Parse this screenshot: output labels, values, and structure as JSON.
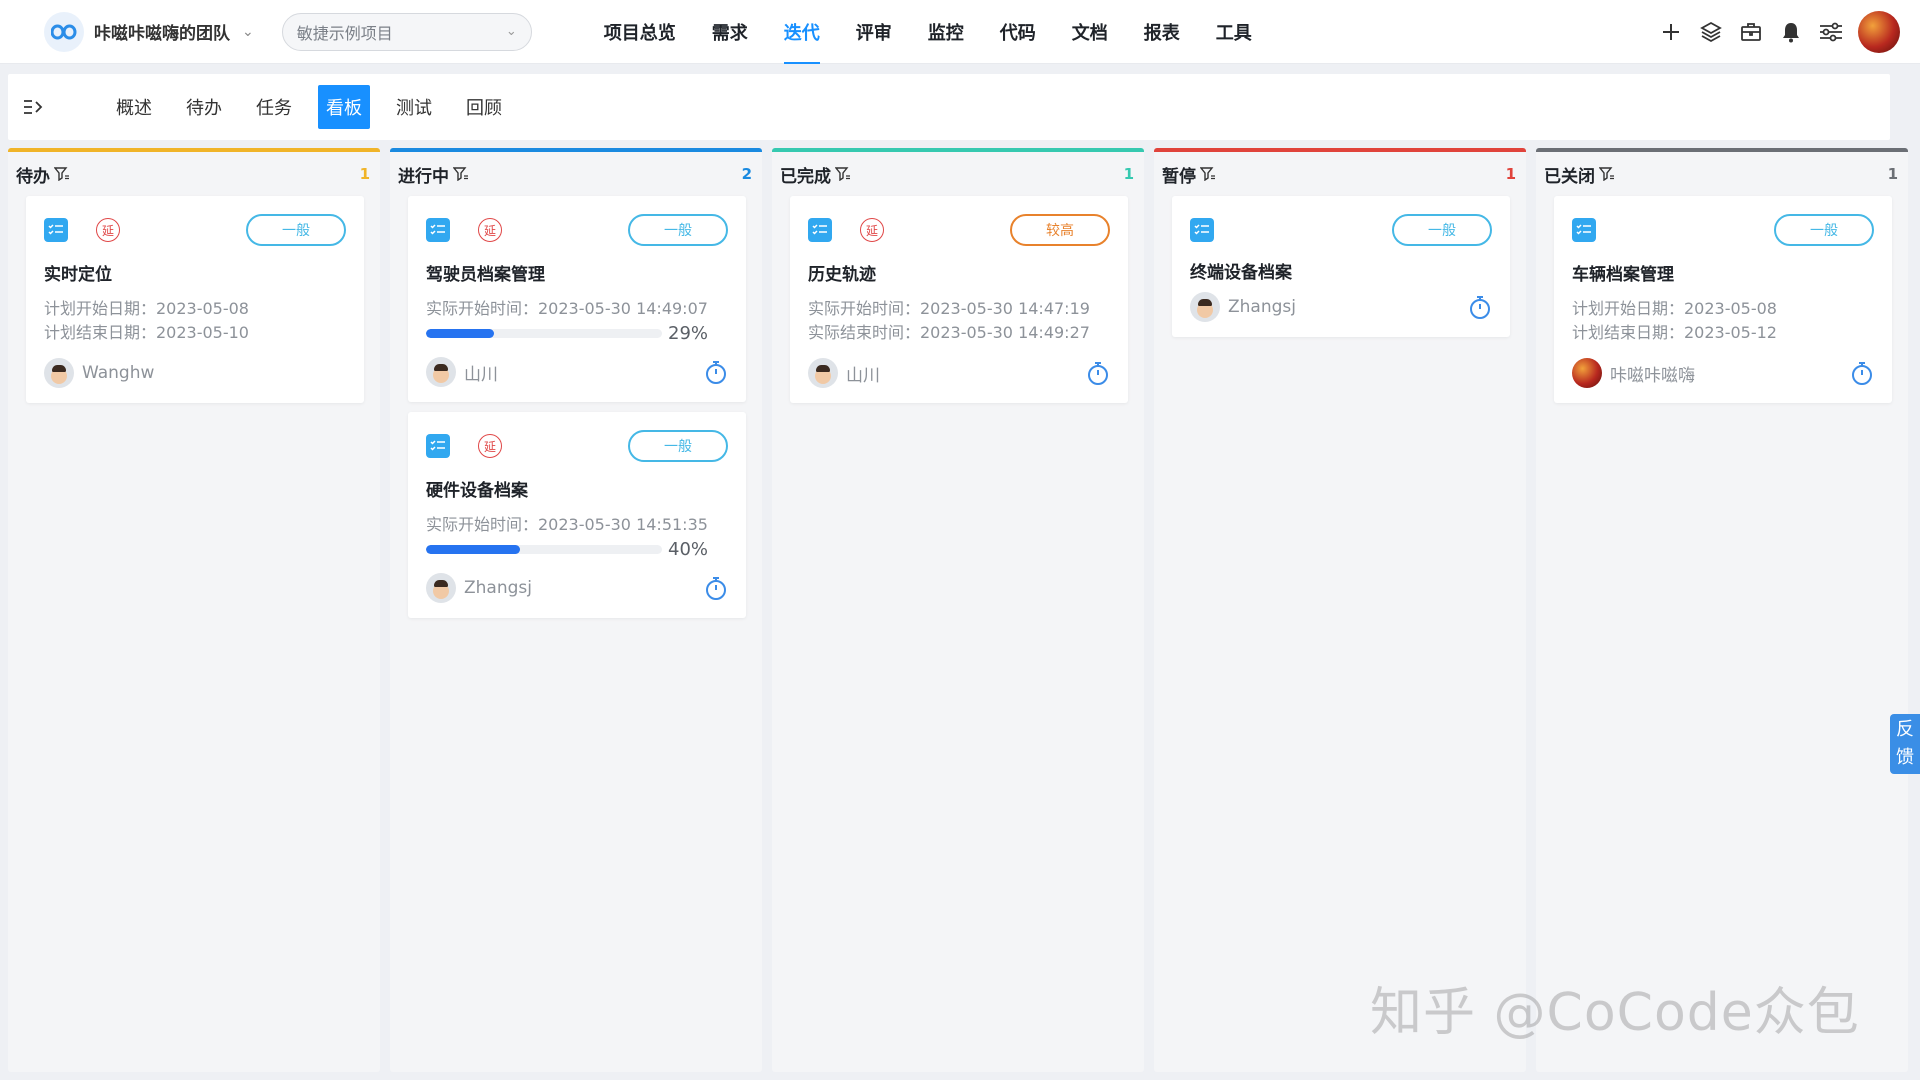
{
  "header": {
    "team_name": "咔嗞咔嗞嗨的团队",
    "project_placeholder": "敏捷示例项目",
    "nav": [
      "项目总览",
      "需求",
      "迭代",
      "评审",
      "监控",
      "代码",
      "文档",
      "报表",
      "工具"
    ],
    "active_nav": "迭代",
    "accent": "#1890ff",
    "tool_icons": [
      "plus-icon",
      "layers-icon",
      "briefcase-icon",
      "bell-icon",
      "settings-sliders-icon",
      "user-avatar"
    ]
  },
  "subnav": {
    "tabs": [
      "概述",
      "待办",
      "任务",
      "看板",
      "测试",
      "回顾"
    ],
    "active_tab": "看板"
  },
  "columns": [
    {
      "title": "待办",
      "count": "1",
      "color": "#f0b429",
      "cards": [
        {
          "delay": "延",
          "priority": "一般",
          "priority_level": "normal",
          "title": "实时定位",
          "meta": [
            "计划开始日期：2023-05-08",
            "计划结束日期：2023-05-10"
          ],
          "user": "Wanghw",
          "timer": false
        }
      ]
    },
    {
      "title": "进行中",
      "count": "2",
      "color": "#1a8ae0",
      "cards": [
        {
          "delay": "延",
          "priority": "一般",
          "priority_level": "normal",
          "title": "驾驶员档案管理",
          "meta": [
            "实际开始时间：2023-05-30 14:49:07"
          ],
          "progress": 0.29,
          "progress_label": "29%",
          "user": "山川",
          "timer": true
        },
        {
          "delay": "延",
          "priority": "一般",
          "priority_level": "normal",
          "title": "硬件设备档案",
          "meta": [
            "实际开始时间：2023-05-30 14:51:35"
          ],
          "progress": 0.4,
          "progress_label": "40%",
          "user": "Zhangsj",
          "timer": true
        }
      ]
    },
    {
      "title": "已完成",
      "count": "1",
      "color": "#36c9b0",
      "cards": [
        {
          "delay": "延",
          "priority": "较高",
          "priority_level": "high",
          "title": "历史轨迹",
          "meta": [
            "实际开始时间：2023-05-30 14:47:19",
            "实际结束时间：2023-05-30 14:49:27"
          ],
          "user": "山川",
          "timer": true
        }
      ]
    },
    {
      "title": "暂停",
      "count": "1",
      "color": "#e0433b",
      "cards": [
        {
          "delay": "",
          "priority": "一般",
          "priority_level": "normal",
          "title": "终端设备档案",
          "meta": [],
          "user": "Zhangsj",
          "timer": true
        }
      ]
    },
    {
      "title": "已关闭",
      "count": "1",
      "color": "#6b6f75",
      "cards": [
        {
          "delay": "",
          "priority": "一般",
          "priority_level": "normal",
          "title": "车辆档案管理",
          "meta": [
            "计划开始日期：2023-05-08",
            "计划结束日期：2023-05-12"
          ],
          "user": "咔嗞咔嗞嗨",
          "timer": true
        }
      ]
    }
  ],
  "feedback": [
    "反",
    "馈"
  ],
  "watermark": "知乎 @CoCode众包"
}
